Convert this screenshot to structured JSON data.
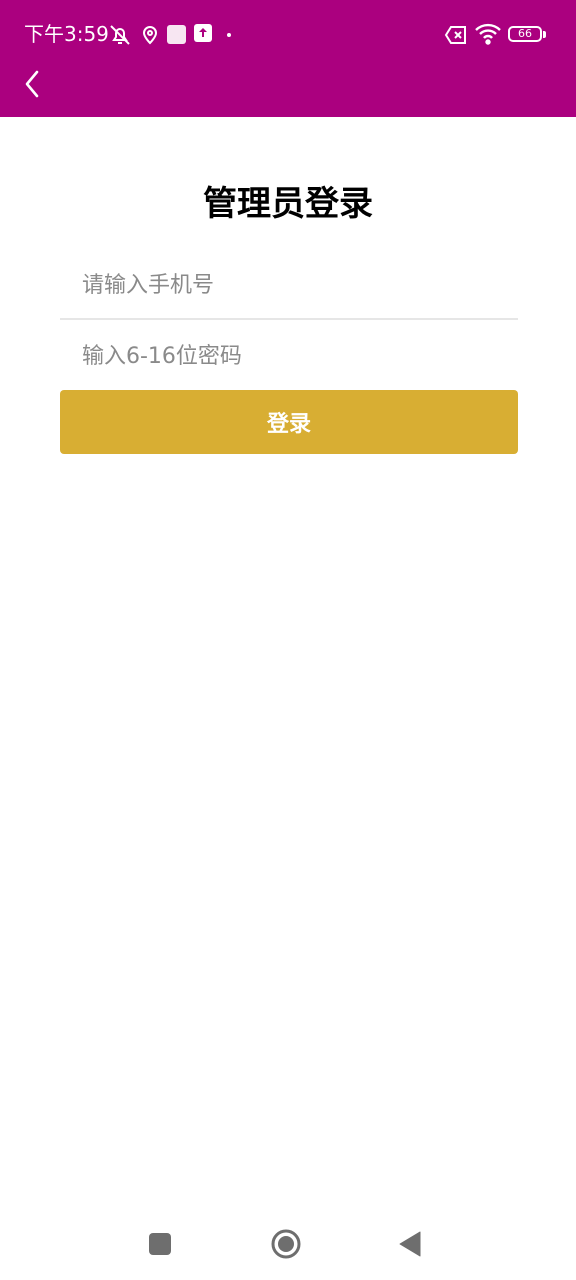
{
  "colors": {
    "header_bg": "#ab007f",
    "button_bg": "#d8ae33",
    "text_primary": "#000000",
    "placeholder": "#8a8a8a",
    "nav_icon": "#6e6e6e"
  },
  "status_bar": {
    "time": "下午3:59",
    "battery_level": "66",
    "icons": [
      "mute-icon",
      "location-icon",
      "app-square-icon",
      "upload-icon",
      "dot-icon",
      "sim-error-icon",
      "wifi-icon",
      "battery-icon"
    ]
  },
  "header": {
    "back_icon": "chevron-left-icon"
  },
  "login": {
    "title": "管理员登录",
    "phone_placeholder": "请输入手机号",
    "password_placeholder": "输入6-16位密码",
    "submit_label": "登录"
  },
  "nav_bar": {
    "icons": [
      "square-icon",
      "home-circle-icon",
      "back-triangle-icon"
    ]
  }
}
